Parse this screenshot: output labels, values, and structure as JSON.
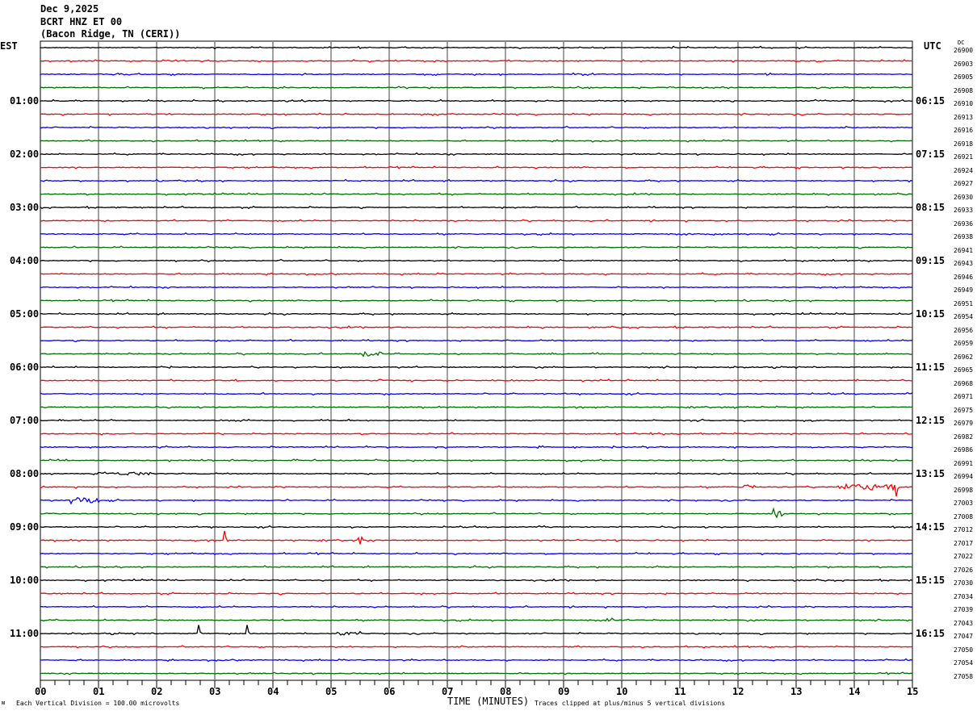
{
  "header": {
    "date": "Dec 9,2025",
    "station": "BCRT HNZ ET 00",
    "location": "(Bacon Ridge, TN (CERI))"
  },
  "left_label": "EST",
  "right_label": "UTC",
  "dc_label": "DC",
  "est_hours": [
    "01:00",
    "02:00",
    "03:00",
    "04:00",
    "05:00",
    "06:00",
    "07:00",
    "08:00",
    "09:00",
    "10:00",
    "11:00"
  ],
  "utc_hours": [
    "06:15",
    "07:15",
    "08:15",
    "09:15",
    "10:15",
    "11:15",
    "12:15",
    "13:15",
    "14:15",
    "15:15",
    "16:15"
  ],
  "dc_values": [
    "26900",
    "26903",
    "26905",
    "26908",
    "26910",
    "26913",
    "26916",
    "26918",
    "26921",
    "26924",
    "26927",
    "26930",
    "26933",
    "26936",
    "26938",
    "26941",
    "26943",
    "26946",
    "26949",
    "26951",
    "26954",
    "26956",
    "26959",
    "26962",
    "26965",
    "26968",
    "26971",
    "26975",
    "26979",
    "26982",
    "26986",
    "26991",
    "26994",
    "26998",
    "27003",
    "27008",
    "27012",
    "27017",
    "27022",
    "27026",
    "27030",
    "27034",
    "27039",
    "27043",
    "27047",
    "27050",
    "27054",
    "27058"
  ],
  "footer": {
    "scale_note": "Each Vertical Division =  100.00 microvolts",
    "xlabel": "TIME (MINUTES)",
    "clip_note": "Traces clipped at plus/minus 5 vertical divisions"
  },
  "chart_data": {
    "type": "line",
    "subtype": "helicorder",
    "xlabel": "TIME (MINUTES)",
    "xlim": [
      0,
      15
    ],
    "x_ticks": [
      "00",
      "01",
      "02",
      "03",
      "04",
      "05",
      "06",
      "07",
      "08",
      "09",
      "10",
      "11",
      "12",
      "13",
      "14",
      "15"
    ],
    "traces_per_hour": 4,
    "trace_count": 48,
    "trace_colors": [
      "#000000",
      "#ff0000",
      "#0000ff",
      "#007000"
    ],
    "grid": true,
    "events": [
      {
        "trace": 23,
        "minute": 5.5,
        "duration": 0.4,
        "amplitude": 2
      },
      {
        "trace": 32,
        "minute": 1.0,
        "duration": 0.9,
        "amplitude": 1.5
      },
      {
        "trace": 33,
        "minute": 12.1,
        "duration": 0.2,
        "amplitude": 3
      },
      {
        "trace": 33,
        "minute": 13.7,
        "duration": 1.0,
        "amplitude": 3
      },
      {
        "trace": 33,
        "minute": 14.7,
        "duration": 0.05,
        "amplitude": -8
      },
      {
        "trace": 34,
        "minute": 0.5,
        "duration": 0.5,
        "amplitude": 3
      },
      {
        "trace": 35,
        "minute": 12.6,
        "duration": 0.2,
        "amplitude": 4
      },
      {
        "trace": 37,
        "minute": 3.15,
        "duration": 0.05,
        "amplitude": 8
      },
      {
        "trace": 37,
        "minute": 5.45,
        "duration": 0.1,
        "amplitude": 4
      },
      {
        "trace": 43,
        "minute": 9.7,
        "duration": 0.2,
        "amplitude": 2
      },
      {
        "trace": 44,
        "minute": 2.7,
        "duration": 0.05,
        "amplitude": 7
      },
      {
        "trace": 44,
        "minute": 3.55,
        "duration": 0.05,
        "amplitude": 7
      },
      {
        "trace": 44,
        "minute": 5.1,
        "duration": 0.4,
        "amplitude": 2
      }
    ]
  }
}
